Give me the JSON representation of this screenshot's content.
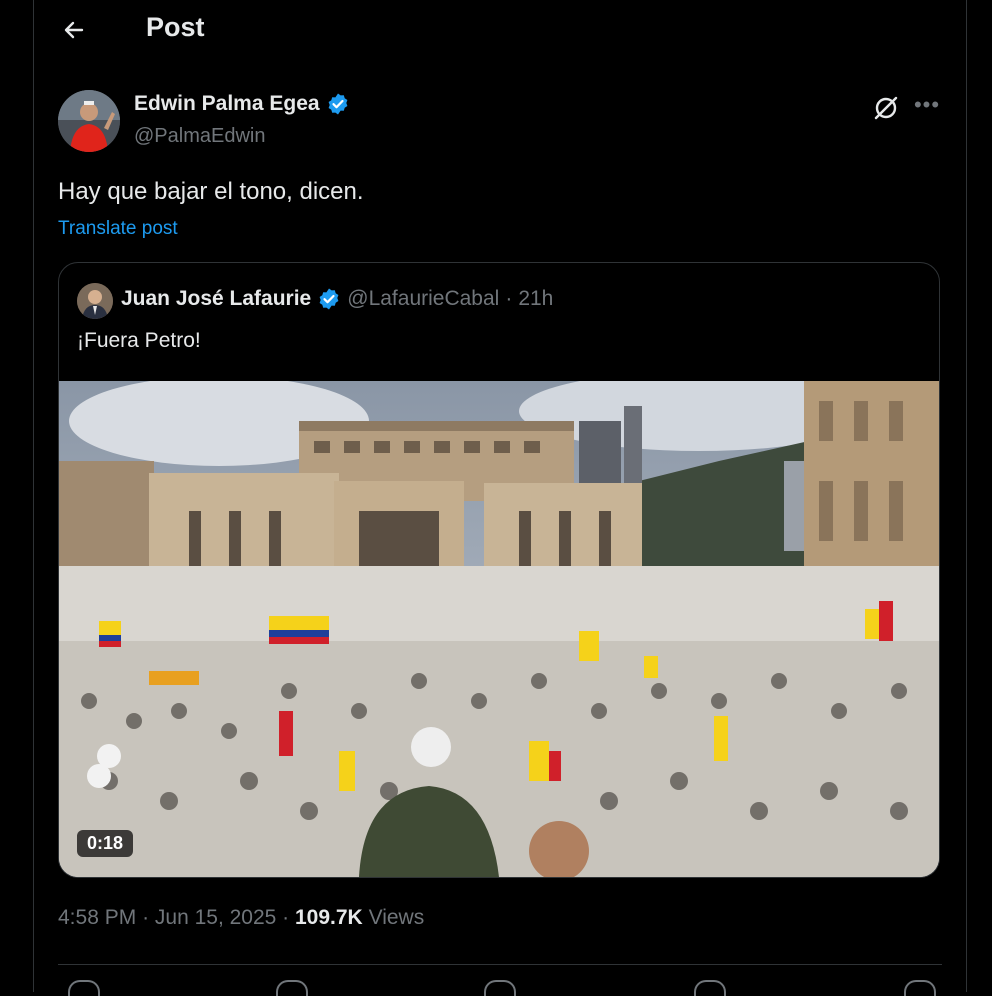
{
  "header": {
    "title": "Post"
  },
  "post": {
    "author_name": "Edwin Palma Egea",
    "author_handle": "@PalmaEdwin",
    "text": "Hay que bajar el tono, dicen.",
    "translate_label": "Translate post",
    "time": "4:58 PM",
    "date": "Jun 15, 2025",
    "views_count": "109.7K",
    "views_label": "Views"
  },
  "quote": {
    "author_name": "Juan José Lafaurie",
    "author_handle": "@LafaurieCabal",
    "age": "21h",
    "text": "¡Fuera Petro!",
    "video_duration": "0:18"
  },
  "colors": {
    "accent": "#1d9bf0",
    "muted": "#71767b",
    "text": "#e7e9ea",
    "border": "#2f3336",
    "background": "#000000"
  },
  "icons": [
    "back-arrow-icon",
    "verified-badge-icon",
    "grok-icon",
    "more-icon",
    "reply-icon",
    "repost-icon",
    "like-icon",
    "bookmark-icon",
    "share-icon"
  ]
}
